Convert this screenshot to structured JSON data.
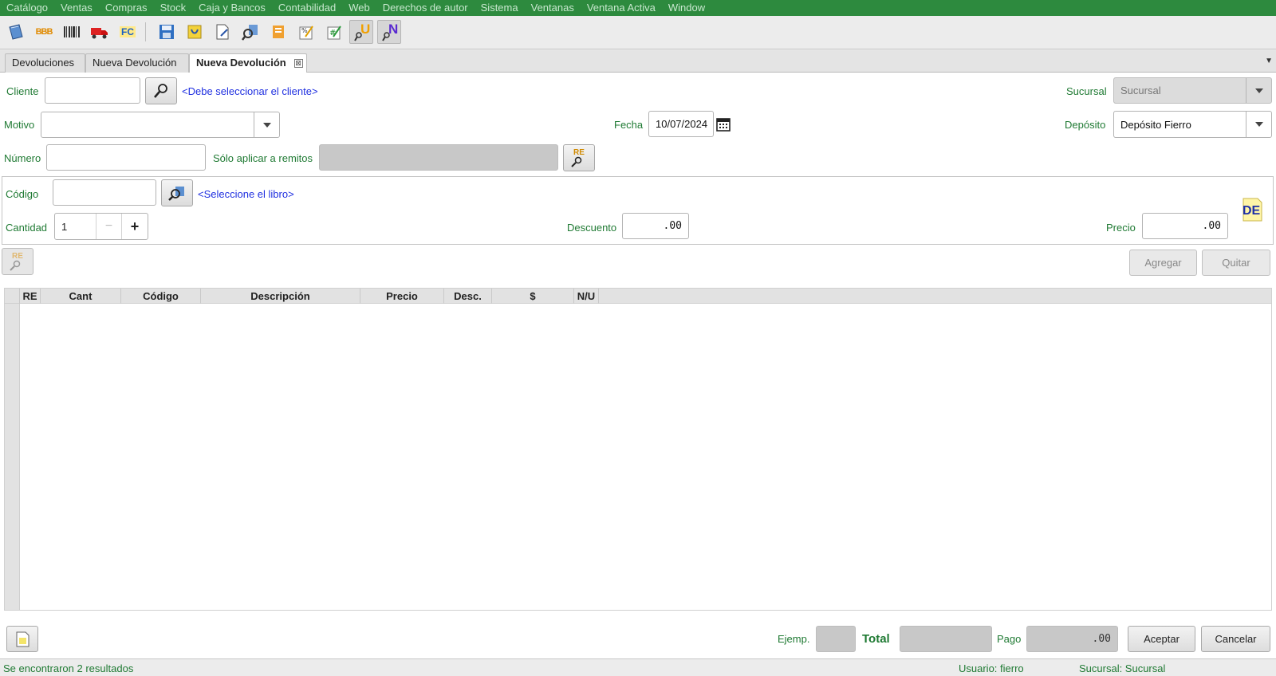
{
  "menu": [
    "Catálogo",
    "Ventas",
    "Compras",
    "Stock",
    "Caja y Bancos",
    "Contabilidad",
    "Web",
    "Derechos de autor",
    "Sistema",
    "Ventanas",
    "Ventana Activa",
    "Window"
  ],
  "toolbar": {
    "bbb_text": "BBB",
    "fc_text": "FC",
    "u_text": "U",
    "n_text": "N"
  },
  "tabs": {
    "t1": "Devoluciones",
    "t2": "Nueva Devolución",
    "t3": "Nueva Devolución",
    "close_glyph": "⊠"
  },
  "form": {
    "cliente_label": "Cliente",
    "cliente_value": "",
    "cliente_hint": "<Debe seleccionar el cliente>",
    "sucursal_label": "Sucursal",
    "sucursal_value": "Sucursal",
    "motivo_label": "Motivo",
    "motivo_value": "",
    "fecha_label": "Fecha",
    "fecha_value": "10/07/2024",
    "deposito_label": "Depósito",
    "deposito_value": "Depósito Fierro",
    "numero_label": "Número",
    "numero_value": "",
    "remitos_label": "Sólo aplicar a remitos",
    "remitos_value": "",
    "re_badge": "RE"
  },
  "item": {
    "codigo_label": "Código",
    "codigo_value": "",
    "codigo_hint": "<Seleccione el libro>",
    "cantidad_label": "Cantidad",
    "cantidad_value": "1",
    "minus": "−",
    "plus": "+",
    "descuento_label": "Descuento",
    "descuento_value": ".00",
    "precio_label": "Precio",
    "precio_value": ".00",
    "de_badge": "DE"
  },
  "actions": {
    "agregar": "Agregar",
    "quitar": "Quitar"
  },
  "table": {
    "columns": [
      "RE",
      "Cant",
      "Código",
      "Descripción",
      "Precio",
      "Desc.",
      "$",
      "N/U"
    ],
    "rows": []
  },
  "footer": {
    "ejemp_label": "Ejemp.",
    "ejemp_value": "",
    "total_label": "Total",
    "total_value": "",
    "pago_label": "Pago",
    "pago_value": ".00",
    "aceptar": "Aceptar",
    "cancelar": "Cancelar"
  },
  "status": {
    "message": "Se encontraron 2 resultados",
    "usuario": "Usuario: fierro",
    "sucursal": "Sucursal: Sucursal"
  },
  "colors": {
    "menubar": "#2d8a3e",
    "label_green": "#1f7a33",
    "hint_blue": "#2030e0"
  }
}
